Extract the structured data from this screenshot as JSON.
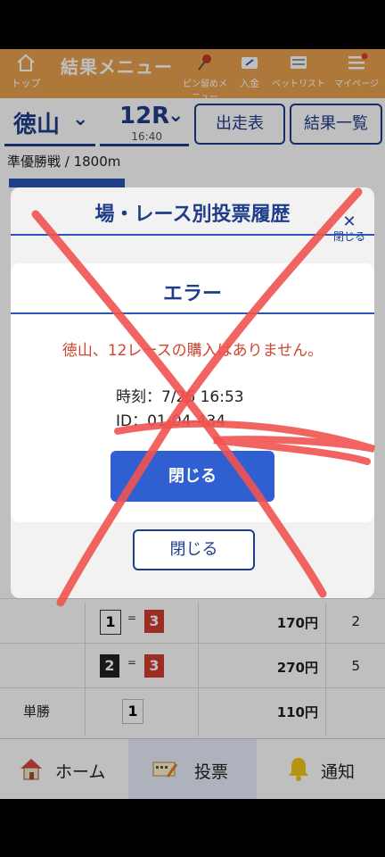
{
  "header": {
    "title": "結果メニュー",
    "items": [
      {
        "label": "トップ",
        "icon": "home-icon"
      },
      {
        "label": "ピン留めメニュー",
        "icon": "pin-icon"
      },
      {
        "label": "入金",
        "icon": "deposit-icon"
      },
      {
        "label": "ベットリスト",
        "icon": "betlist-icon"
      },
      {
        "label": "マイページ",
        "icon": "menu-icon"
      }
    ]
  },
  "selectors": {
    "venue": "徳山",
    "race": "12R",
    "race_time": "16:40",
    "entry_button": "出走表",
    "results_button": "結果一覧"
  },
  "race_info": "準優勝戦 / 1800m",
  "results_rows": [
    {
      "box1": "1",
      "eq": "=",
      "box2": "3",
      "amount": "170円",
      "rank": "2"
    },
    {
      "box1": "2",
      "eq": "=",
      "box2": "3",
      "amount": "270円",
      "rank": "5"
    },
    {
      "type": "単勝",
      "box1": "1",
      "amount": "110円"
    }
  ],
  "nav": {
    "home": "ホーム",
    "vote": "投票",
    "notify": "通知"
  },
  "history_modal": {
    "title": "場・レース別投票履歴",
    "close_label": "閉じる",
    "close_button": "閉じる"
  },
  "error_modal": {
    "title": "エラー",
    "message": "徳山、12レースの購入はありません。",
    "time": "時刻：7/26 16:53",
    "id": "ID：01-04-434",
    "close_button": "閉じる"
  },
  "colors": {
    "header": "#e8a14e",
    "primary": "#1f3d8a",
    "button": "#2f5fd0",
    "error_text": "#d04432",
    "scribble": "#ef5350"
  }
}
